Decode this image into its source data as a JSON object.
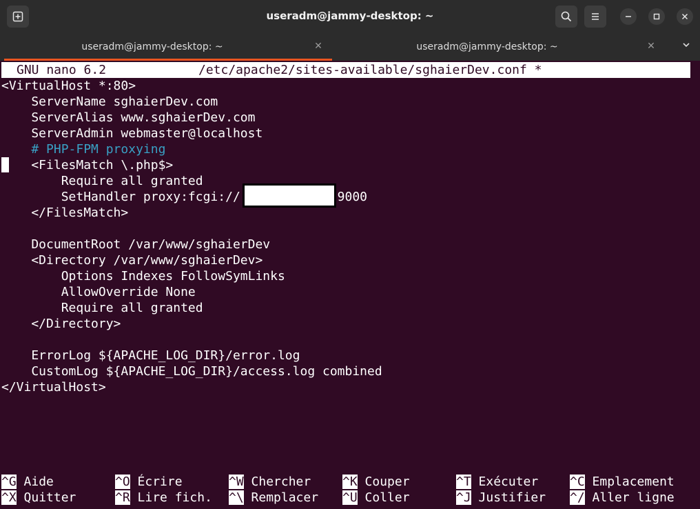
{
  "window": {
    "title": "useradm@jammy-desktop: ~"
  },
  "tabs": [
    {
      "label": "useradm@jammy-desktop: ~",
      "active": true
    },
    {
      "label": "useradm@jammy-desktop: ~",
      "active": false
    }
  ],
  "nano": {
    "version": "GNU nano 6.2",
    "filename": "/etc/apache2/sites-available/sghaierDev.conf *"
  },
  "file_lines": [
    "<VirtualHost *:80>",
    "    ServerName sghaierDev.com",
    "    ServerAlias www.sghaierDev.com",
    "    ServerAdmin webmaster@localhost",
    "    # PHP-FPM proxying",
    "    <FilesMatch \\.php$>",
    "        Require all granted",
    "        SetHandler proxy:fcgi://            :9000",
    "    </FilesMatch>",
    "",
    "    DocumentRoot /var/www/sghaierDev",
    "    <Directory /var/www/sghaierDev>",
    "        Options Indexes FollowSymLinks",
    "        AllowOverride None",
    "        Require all granted",
    "    </Directory>",
    "",
    "    ErrorLog ${APACHE_LOG_DIR}/error.log",
    "    CustomLog ${APACHE_LOG_DIR}/access.log combined",
    "</VirtualHost>"
  ],
  "shortcuts_row1": [
    {
      "key": "^G",
      "label": "Aide"
    },
    {
      "key": "^O",
      "label": "Écrire"
    },
    {
      "key": "^W",
      "label": "Chercher"
    },
    {
      "key": "^K",
      "label": "Couper"
    },
    {
      "key": "^T",
      "label": "Exécuter"
    },
    {
      "key": "^C",
      "label": "Emplacement"
    }
  ],
  "shortcuts_row2": [
    {
      "key": "^X",
      "label": "Quitter"
    },
    {
      "key": "^R",
      "label": "Lire fich."
    },
    {
      "key": "^\\",
      "label": "Remplacer"
    },
    {
      "key": "^U",
      "label": "Coller"
    },
    {
      "key": "^J",
      "label": "Justifier"
    },
    {
      "key": "^/",
      "label": "Aller ligne"
    }
  ],
  "icons": {
    "new_tab": "new-tab-icon",
    "search": "search-icon",
    "menu": "hamburger-menu-icon",
    "minimize": "minimize-icon",
    "maximize": "maximize-icon",
    "close": "close-icon"
  },
  "colors": {
    "terminal_bg": "#300a24",
    "comment": "#39a0c4",
    "tab_accent": "#e95420"
  }
}
